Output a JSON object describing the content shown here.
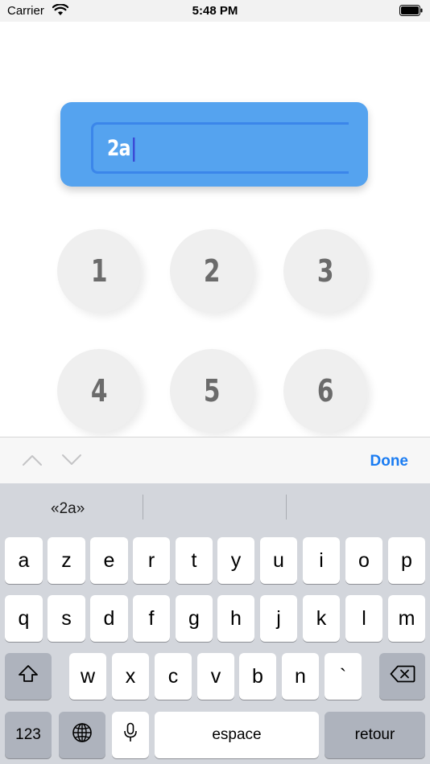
{
  "status_bar": {
    "carrier": "Carrier",
    "time": "5:48 PM"
  },
  "input": {
    "value": "2a"
  },
  "keypad": {
    "keys": [
      "1",
      "2",
      "3",
      "4",
      "5",
      "6"
    ]
  },
  "accessory_bar": {
    "done_label": "Done"
  },
  "keyboard": {
    "suggestions": [
      "«2a»",
      "",
      ""
    ],
    "row1": [
      "a",
      "z",
      "e",
      "r",
      "t",
      "y",
      "u",
      "i",
      "o",
      "p"
    ],
    "row2": [
      "q",
      "s",
      "d",
      "f",
      "g",
      "h",
      "j",
      "k",
      "l",
      "m"
    ],
    "row3": [
      "w",
      "x",
      "c",
      "v",
      "b",
      "n",
      "`"
    ],
    "numbers_label": "123",
    "space_label": "espace",
    "return_label": "retour"
  },
  "icons": [
    "wifi-icon",
    "battery-icon",
    "caret",
    "chevron-up-icon",
    "chevron-down-icon",
    "shift-icon",
    "backspace-icon",
    "globe-icon",
    "microphone-icon"
  ],
  "colors": {
    "input_card": "#55a3ef",
    "input_border": "#3b86ea",
    "done": "#1a7cf2",
    "keyboard_bg": "#d3d6dc"
  }
}
